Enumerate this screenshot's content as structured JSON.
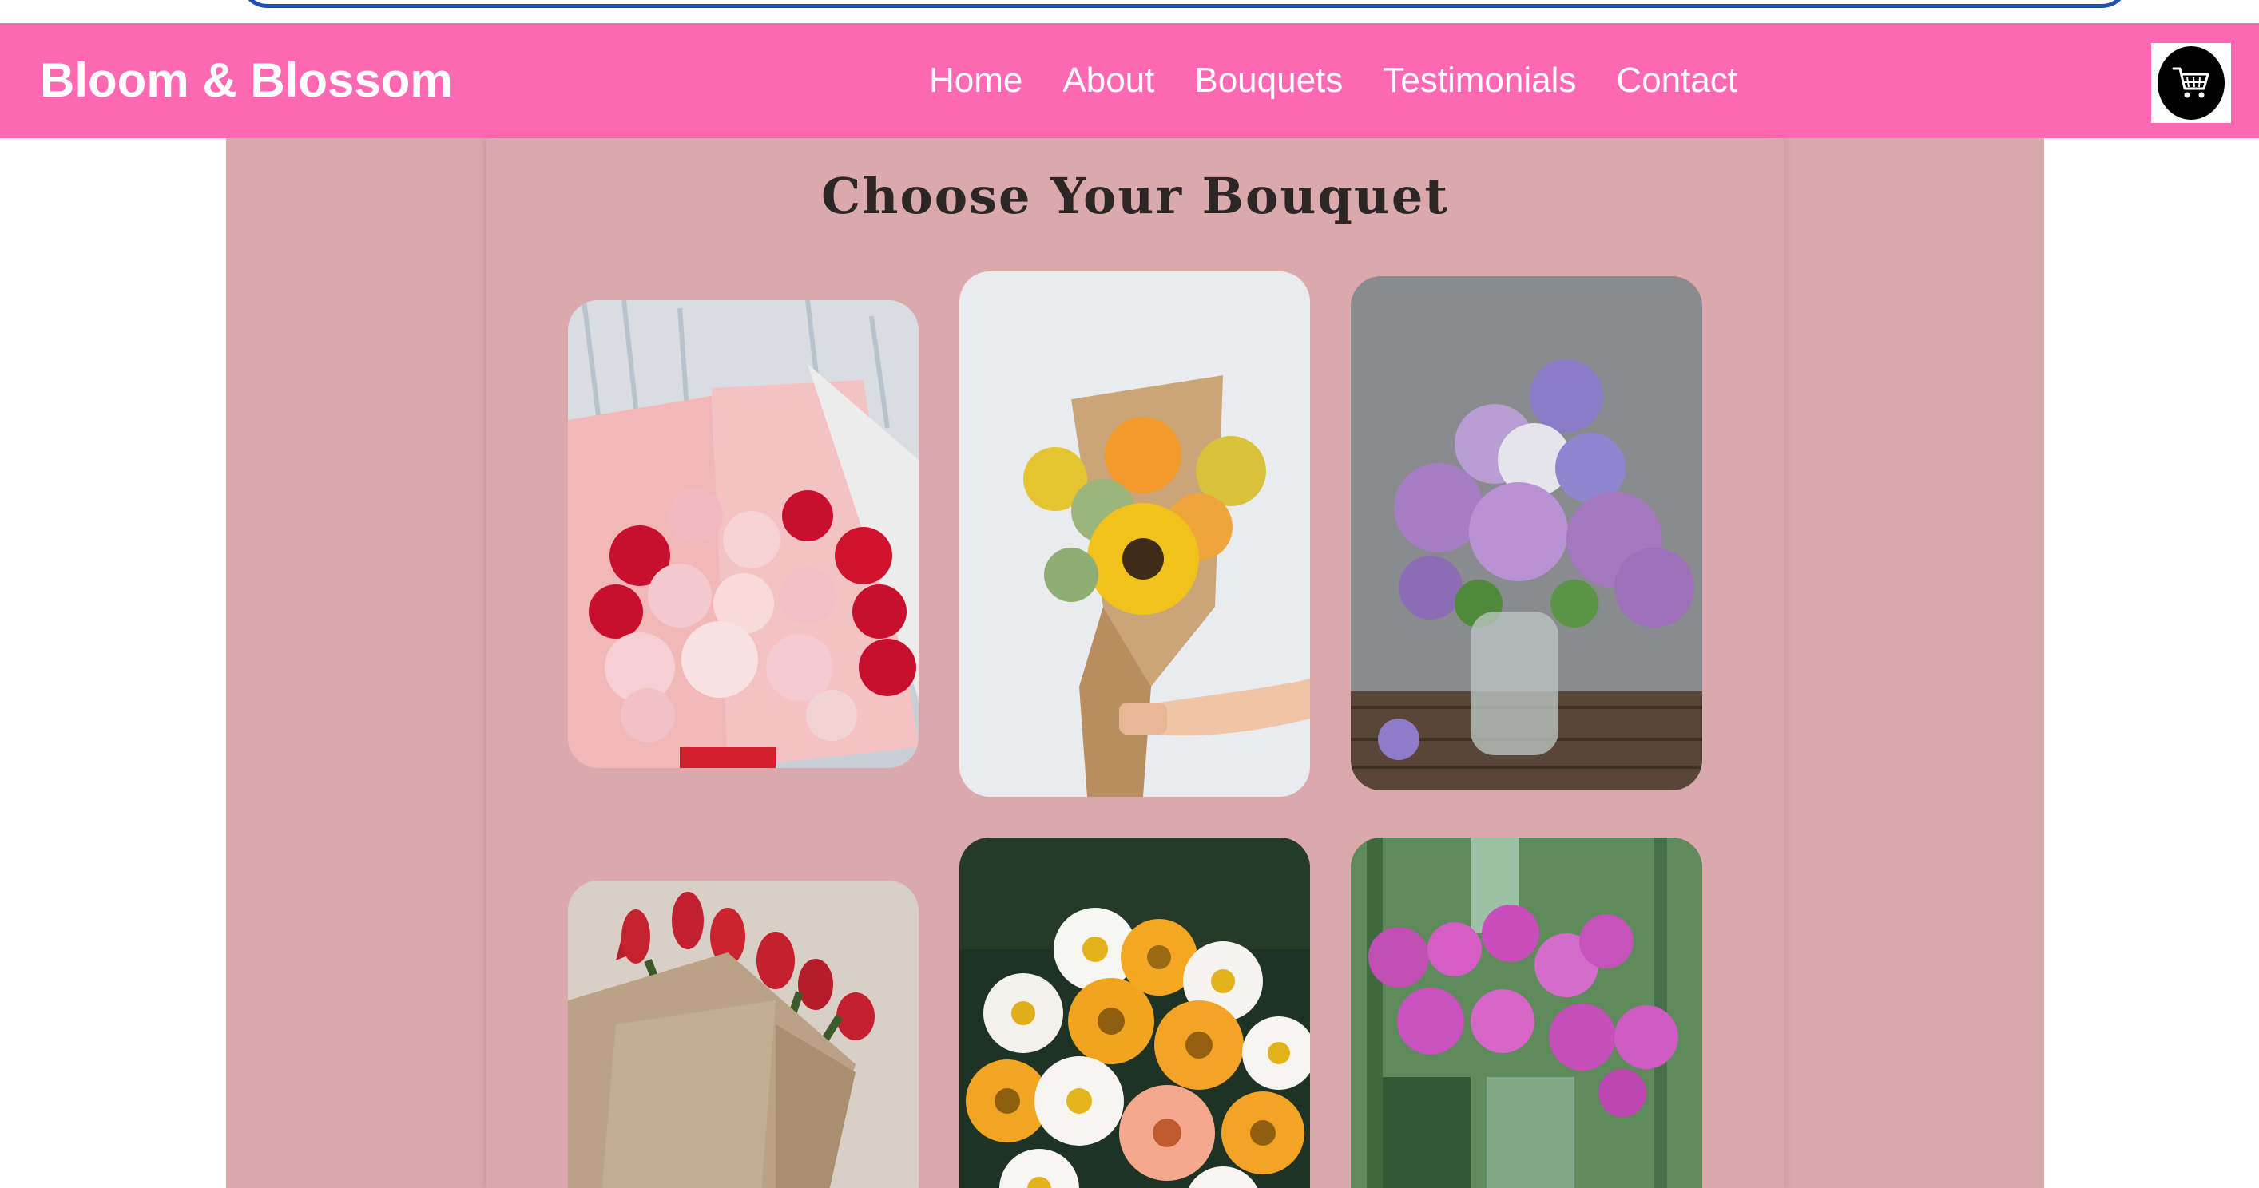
{
  "header": {
    "brand": "Bloom & Blossom",
    "nav": [
      {
        "label": "Home"
      },
      {
        "label": "About"
      },
      {
        "label": "Bouquets"
      },
      {
        "label": "Testimonials"
      },
      {
        "label": "Contact"
      }
    ],
    "cart_icon": "shopping-cart-icon"
  },
  "main": {
    "title": "Choose Your Bouquet",
    "bouquets": [
      {
        "image": "pink-and-red-roses-bouquet"
      },
      {
        "image": "sunflower-bouquet-in-kraft-paper"
      },
      {
        "image": "lilac-in-glass-vase"
      },
      {
        "image": "red-tulips-in-kraft-paper"
      },
      {
        "image": "daisies-and-gerberas"
      },
      {
        "image": "purple-orchids-in-vase"
      }
    ]
  },
  "colors": {
    "navbar": "#ff69b4",
    "overlay": "#dba9ac",
    "title": "#2d2626",
    "top_outline": "#1f4fb5"
  }
}
